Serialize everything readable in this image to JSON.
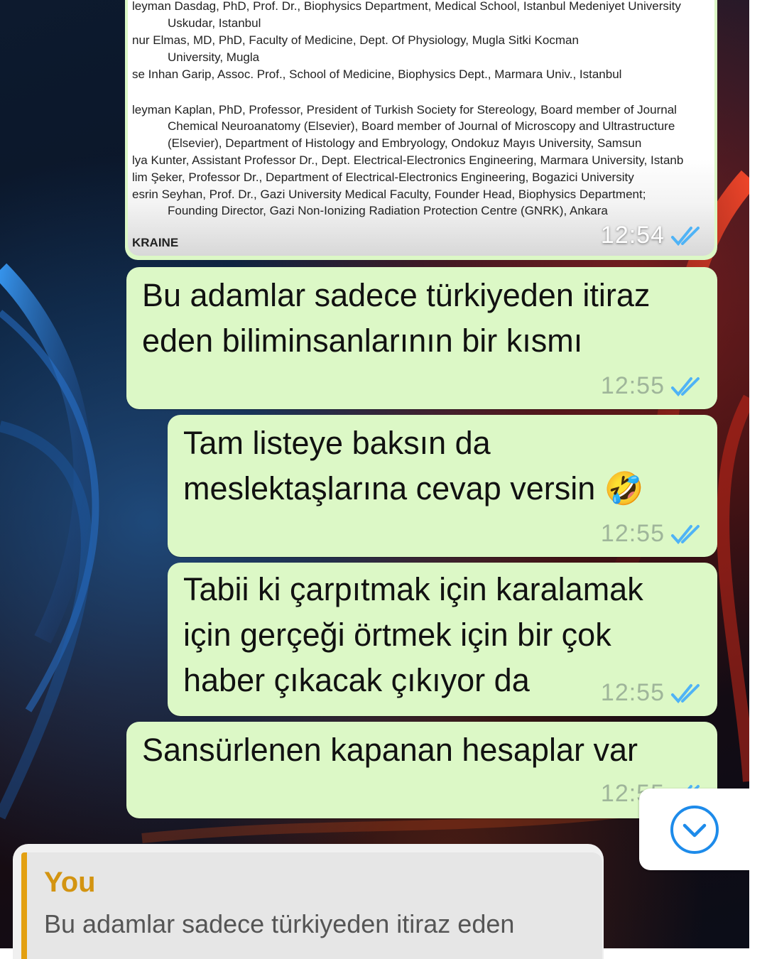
{
  "document_image": {
    "lines": [
      {
        "text": "leyman Dasdag, PhD, Prof. Dr., Biophysics Department, Medical School, Istanbul Medeniyet University",
        "indent": false
      },
      {
        "text": "Uskudar, Istanbul",
        "indent": true
      },
      {
        "text": "nur Elmas, MD, PhD, Faculty of Medicine, Dept. Of Physiology, Mugla Sitki Kocman",
        "indent": false
      },
      {
        "text": "University, Mugla",
        "indent": true
      },
      {
        "text": "se Inhan Garip, Assoc. Prof., School of Medicine, Biophysics Dept., Marmara Univ., Istanbul",
        "indent": false
      },
      {
        "text": "leyman Kaplan, PhD, Professor, President of Turkish Society for Stereology, Board member of Journal",
        "indent": false
      },
      {
        "text": "Chemical Neuroanatomy (Elsevier), Board member of Journal of Microscopy and Ultrastructure",
        "indent": true
      },
      {
        "text": "(Elsevier), Department of Histology and Embryology, Ondokuz Mayıs University, Samsun",
        "indent": true
      },
      {
        "text": "lya Kunter, Assistant Professor Dr., Dept. Electrical-Electronics Engineering, Marmara University, Istanb",
        "indent": false
      },
      {
        "text": "lim Şeker, Professor Dr., Department of Electrical-Electronics Engineering, Bogazici University",
        "indent": false
      },
      {
        "text": "esrin Seyhan, Prof. Dr., Gazi University Medical Faculty, Founder Head, Biophysics Department;",
        "indent": false
      },
      {
        "text": "Founding Director, Gazi Non-Ionizing Radiation Protection Centre (GNRK), Ankara",
        "indent": true
      }
    ],
    "caption": "KRAINE",
    "time": "12:54"
  },
  "messages": [
    {
      "text": "Bu adamlar sadece türkiyeden itiraz\neden biliminsanlarının bir kısmı",
      "time": "12:55"
    },
    {
      "text": "Tam listeye baksın da\nmeslektaşlarına cevap versin 🤣",
      "time": "12:55"
    },
    {
      "text": "Tabii ki çarpıtmak için karalamak\niçin gerçeği örtmek için bir çok\nhaber çıkacak çıkıyor da",
      "time": "12:55"
    },
    {
      "text": "Sansürlenen kapanan hesaplar var",
      "time": "12:55"
    }
  ],
  "reply_preview": {
    "author": "You",
    "text": "Bu adamlar sadece türkiyeden itiraz eden"
  },
  "colors": {
    "bubble": "#dcf8c6",
    "tick_read": "#4fb3f6",
    "reply_accent": "#e3a012"
  },
  "icons": {
    "read_receipt": "double-check-icon",
    "scroll_down": "chevron-down-circle-icon"
  }
}
